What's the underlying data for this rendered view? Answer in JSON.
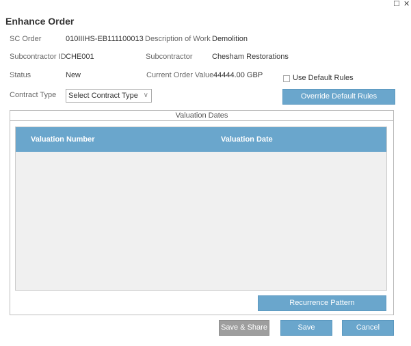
{
  "window": {
    "minimize_glyph": "☐",
    "close_glyph": "✕"
  },
  "dialog": {
    "title": "Enhance Order"
  },
  "fields": {
    "sc_order_label": "SC Order",
    "sc_order_value": "010IIIHS-EB111100013",
    "description_label": "Description of Work",
    "description_value": "Demolition",
    "subcontractor_id_label": "Subcontractor ID",
    "subcontractor_id_value": "CHE001",
    "subcontractor_label": "Subcontractor",
    "subcontractor_value": "Chesham Restorations",
    "status_label": "Status",
    "status_value": "New",
    "current_order_value_label": "Current Order Value",
    "current_order_value_value": "44444.00 GBP",
    "contract_type_label": "Contract Type",
    "contract_type_value": "Select Contract Type"
  },
  "options": {
    "use_default_rules_label": "Use Default Rules",
    "use_default_rules_checked": false,
    "override_button": "Override Default Rules"
  },
  "valuation": {
    "section_title": "Valuation Dates",
    "columns": [
      "Valuation Number",
      "Valuation Date"
    ],
    "rows": [],
    "recurrence_button": "Recurrence Pattern"
  },
  "footer": {
    "save_share": "Save & Share",
    "save": "Save",
    "cancel": "Cancel"
  },
  "colors": {
    "accent": "#6aa6cc",
    "disabled": "#9e9e9e"
  }
}
